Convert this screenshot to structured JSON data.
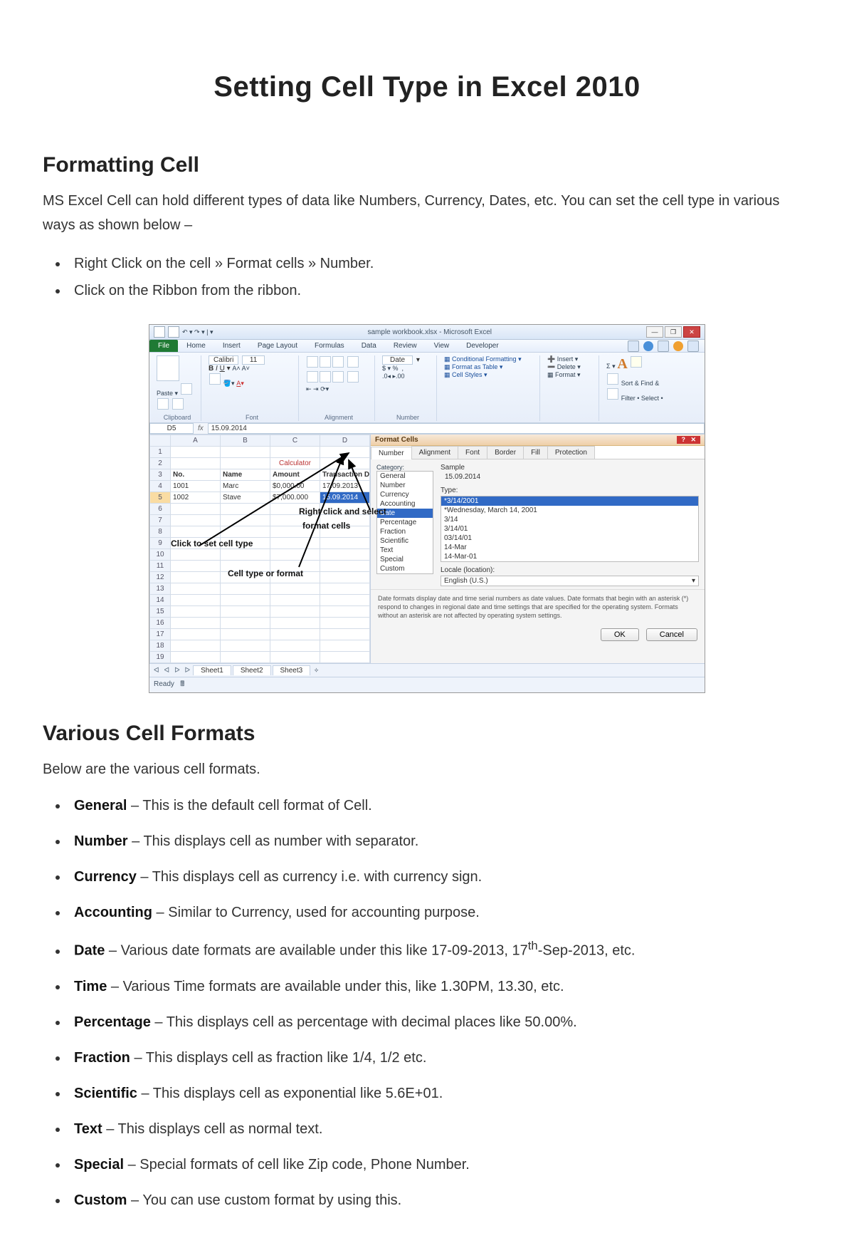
{
  "title": "Setting Cell Type in Excel 2010",
  "section1": {
    "heading": "Formatting Cell",
    "intro": "MS Excel Cell can hold different types of data like Numbers, Currency, Dates, etc. You can set the cell type in various ways as shown below –",
    "bullets": [
      "Right Click on the cell » Format cells » Number.",
      "Click on the Ribbon from the ribbon."
    ]
  },
  "screenshot": {
    "window_title": "sample workbook.xlsx  -  Microsoft Excel",
    "ribbon_tabs": [
      "File",
      "Home",
      "Insert",
      "Page Layout",
      "Formulas",
      "Data",
      "Review",
      "View",
      "Developer"
    ],
    "font_name": "Calibri",
    "font_size": "11",
    "number_group_label": "Date",
    "styles": {
      "cond": "Conditional Formatting",
      "table": "Format as Table",
      "cells": "Cell Styles"
    },
    "cells_grp": {
      "insert": "Insert",
      "delete": "Delete",
      "format": "Format"
    },
    "editing": {
      "sort": "Sort & Find &",
      "filter": "Filter • Select •"
    },
    "clipboard_label": "Clipboard",
    "font_label": "Font",
    "align_label": "Alignment",
    "num_label": "Number",
    "name_box": "D5",
    "fx_value": "15.09.2014",
    "columns": [
      "",
      "A",
      "B",
      "C",
      "D"
    ],
    "calculator_text": "Calculator",
    "headers": {
      "no": "No.",
      "name": "Name",
      "amount": "Amount",
      "date": "Transaction Date"
    },
    "rows": [
      {
        "r": "4",
        "no": "1001",
        "name": "Marc",
        "amt": "$0,000.00",
        "date": "17.09.2013"
      },
      {
        "r": "5",
        "no": "1002",
        "name": "Stave",
        "amt": "$7,000.000",
        "date": "15.09.2014"
      }
    ],
    "annotations": {
      "a1": "Right click and select",
      "a2": "format cells",
      "a3": "Click to set cell type",
      "a4": "Cell type or format"
    },
    "dialog": {
      "title": "Format Cells",
      "tabs": [
        "Number",
        "Alignment",
        "Font",
        "Border",
        "Fill",
        "Protection"
      ],
      "cat_label": "Category:",
      "categories": [
        "General",
        "Number",
        "Currency",
        "Accounting",
        "Date",
        "Percentage",
        "Fraction",
        "Scientific",
        "Text",
        "Special",
        "Custom"
      ],
      "selected_category_index": 4,
      "sample_label": "Sample",
      "sample_value": "15.09.2014",
      "type_label": "Type:",
      "types": [
        "*3/14/2001",
        "*Wednesday, March 14, 2001",
        "3/14",
        "3/14/01",
        "03/14/01",
        "14-Mar",
        "14-Mar-01"
      ],
      "selected_type_index": 0,
      "locale_label": "Locale (location):",
      "locale_value": "English (U.S.)",
      "description": "Date formats display date and time serial numbers as date values. Date formats that begin with an asterisk (*) respond to changes in regional date and time settings that are specified for the operating system. Formats without an asterisk are not affected by operating system settings.",
      "ok": "OK",
      "cancel": "Cancel"
    },
    "sheet_tabs": [
      "Sheet1",
      "Sheet2",
      "Sheet3"
    ],
    "status": "Ready"
  },
  "section2": {
    "heading": "Various Cell Formats",
    "intro": "Below are the various cell formats.",
    "items": [
      {
        "name": "General",
        "desc": " – This is the default cell format of Cell."
      },
      {
        "name": "Number",
        "desc": " – This displays cell as number with separator."
      },
      {
        "name": "Currency",
        "desc": " – This displays cell as currency i.e. with currency sign."
      },
      {
        "name": "Accounting",
        "desc": " – Similar to Currency, used for accounting purpose."
      },
      {
        "name": "Date",
        "desc": " – Various date formats are available under this like 17-09-2013, 17",
        "sup": "th",
        "desc2": "-Sep-2013, etc."
      },
      {
        "name": "Time",
        "desc": " – Various Time formats are available under this, like 1.30PM, 13.30, etc."
      },
      {
        "name": "Percentage",
        "desc": " – This displays cell as percentage with decimal places like 50.00%."
      },
      {
        "name": "Fraction",
        "desc": " – This displays cell as fraction like 1/4, 1/2 etc."
      },
      {
        "name": "Scientific",
        "desc": " – This displays cell as exponential like 5.6E+01."
      },
      {
        "name": "Text",
        "desc": " – This displays cell as normal text."
      },
      {
        "name": "Special",
        "desc": " – Special formats of cell like Zip code, Phone Number."
      },
      {
        "name": "Custom",
        "desc": " – You can use custom format by using this."
      }
    ]
  }
}
